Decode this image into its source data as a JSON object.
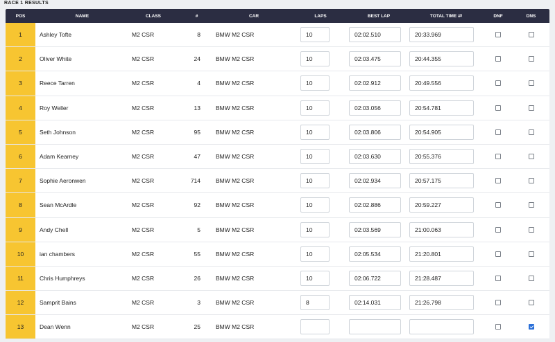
{
  "page": {
    "title": "RACE 1 RESULTS"
  },
  "columns": {
    "pos": "POS",
    "name": "NAME",
    "class": "CLASS",
    "num": "#",
    "car": "CAR",
    "laps": "LAPS",
    "best_lap": "BEST LAP",
    "total_time": "TOTAL TIME",
    "dnf": "DNF",
    "dns": "DNS"
  },
  "icons": {
    "sort": "sort-icon"
  },
  "colors": {
    "header_bg": "#2b2d42",
    "pos_bg": "#f7c531",
    "checkbox_on": "#2a6fd8"
  },
  "rows": [
    {
      "pos": "1",
      "name": "Ashley Tofte",
      "class": "M2 CSR",
      "num": "8",
      "car": "BMW M2 CSR",
      "laps": "10",
      "best_lap": "02:02.510",
      "total_time": "20:33.969",
      "dnf": false,
      "dns": false
    },
    {
      "pos": "2",
      "name": "Oliver White",
      "class": "M2 CSR",
      "num": "24",
      "car": "BMW M2 CSR",
      "laps": "10",
      "best_lap": "02:03.475",
      "total_time": "20:44.355",
      "dnf": false,
      "dns": false
    },
    {
      "pos": "3",
      "name": "Reece Tarren",
      "class": "M2 CSR",
      "num": "4",
      "car": "BMW M2 CSR",
      "laps": "10",
      "best_lap": "02:02.912",
      "total_time": "20:49.556",
      "dnf": false,
      "dns": false
    },
    {
      "pos": "4",
      "name": "Roy Weller",
      "class": "M2 CSR",
      "num": "13",
      "car": "BMW M2 CSR",
      "laps": "10",
      "best_lap": "02:03.056",
      "total_time": "20:54.781",
      "dnf": false,
      "dns": false
    },
    {
      "pos": "5",
      "name": "Seth Johnson",
      "class": "M2 CSR",
      "num": "95",
      "car": "BMW M2 CSR",
      "laps": "10",
      "best_lap": "02:03.806",
      "total_time": "20:54.905",
      "dnf": false,
      "dns": false
    },
    {
      "pos": "6",
      "name": "Adam Kearney",
      "class": "M2 CSR",
      "num": "47",
      "car": "BMW M2 CSR",
      "laps": "10",
      "best_lap": "02:03.630",
      "total_time": "20:55.376",
      "dnf": false,
      "dns": false
    },
    {
      "pos": "7",
      "name": "Sophie Aeronwen",
      "class": "M2 CSR",
      "num": "714",
      "car": "BMW M2 CSR",
      "laps": "10",
      "best_lap": "02:02.934",
      "total_time": "20:57.175",
      "dnf": false,
      "dns": false
    },
    {
      "pos": "8",
      "name": "Sean McArdle",
      "class": "M2 CSR",
      "num": "92",
      "car": "BMW M2 CSR",
      "laps": "10",
      "best_lap": "02:02.886",
      "total_time": "20:59.227",
      "dnf": false,
      "dns": false
    },
    {
      "pos": "9",
      "name": "Andy Chell",
      "class": "M2 CSR",
      "num": "5",
      "car": "BMW M2 CSR",
      "laps": "10",
      "best_lap": "02:03.569",
      "total_time": "21:00.063",
      "dnf": false,
      "dns": false
    },
    {
      "pos": "10",
      "name": "ian chambers",
      "class": "M2 CSR",
      "num": "55",
      "car": "BMW M2 CSR",
      "laps": "10",
      "best_lap": "02:05.534",
      "total_time": "21:20.801",
      "dnf": false,
      "dns": false
    },
    {
      "pos": "11",
      "name": "Chris Humphreys",
      "class": "M2 CSR",
      "num": "26",
      "car": "BMW M2 CSR",
      "laps": "10",
      "best_lap": "02:06.722",
      "total_time": "21:28.487",
      "dnf": false,
      "dns": false
    },
    {
      "pos": "12",
      "name": "Samprit Bains",
      "class": "M2 CSR",
      "num": "3",
      "car": "BMW M2 CSR",
      "laps": "8",
      "best_lap": "02:14.031",
      "total_time": "21:26.798",
      "dnf": false,
      "dns": false
    },
    {
      "pos": "13",
      "name": "Dean Wenn",
      "class": "M2 CSR",
      "num": "25",
      "car": "BMW M2 CSR",
      "laps": "",
      "best_lap": "",
      "total_time": "",
      "dnf": false,
      "dns": true
    }
  ]
}
